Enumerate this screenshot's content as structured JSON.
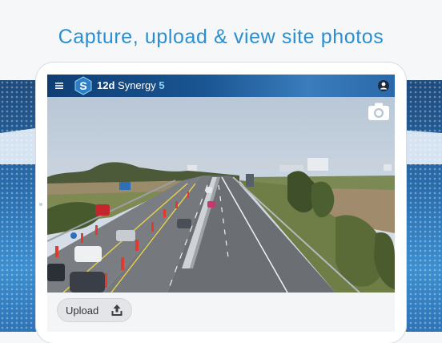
{
  "headline": "Capture, upload & view site photos",
  "app": {
    "brand_prefix": "12d",
    "brand_name": " Synergy ",
    "brand_version": "5"
  },
  "toolbar": {
    "menu_icon": "hamburger-menu-icon",
    "account_icon": "account-icon",
    "camera_icon": "camera-icon"
  },
  "actions": {
    "upload_label": "Upload",
    "upload_icon": "upload-icon"
  },
  "colors": {
    "headline": "#2a8fd0",
    "app_bar": "#1a5592",
    "accent_cyan": "#8fd4f5"
  }
}
